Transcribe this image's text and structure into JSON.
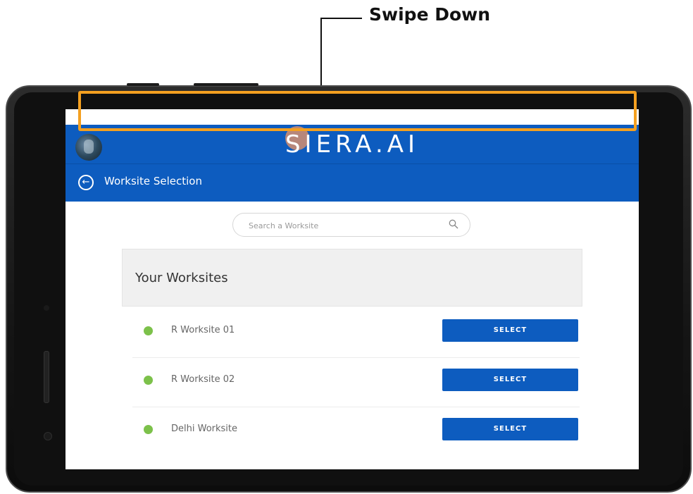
{
  "annotation": {
    "title": "Swipe Down",
    "highlight_color": "#f4a020"
  },
  "app": {
    "logo": "SIERA.AI",
    "header_color": "#0d5cbf",
    "back_icon": "arrow-left-circle-icon",
    "page_title": "Worksite Selection"
  },
  "search": {
    "placeholder": "Search a Worksite",
    "value": "",
    "icon": "search-icon"
  },
  "panel": {
    "title": "Your Worksites"
  },
  "worksites": [
    {
      "name": "R Worksite 01",
      "status_color": "#7cc14a",
      "button": "SELECT"
    },
    {
      "name": "R Worksite 02",
      "status_color": "#7cc14a",
      "button": "SELECT"
    },
    {
      "name": "Delhi Worksite",
      "status_color": "#7cc14a",
      "button": "SELECT"
    }
  ]
}
